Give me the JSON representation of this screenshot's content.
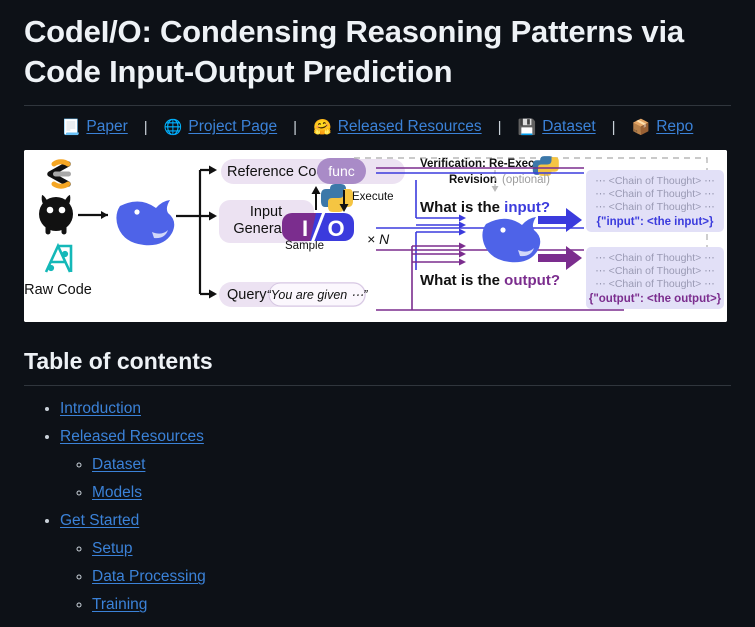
{
  "header": {
    "title": "CodeI/O: Condensing Reasoning Patterns via Code Input-Output Prediction"
  },
  "linkbar": {
    "separator": "|",
    "links": [
      {
        "icon": "page-with-curl-icon",
        "emoji": "📃",
        "label": "Paper"
      },
      {
        "icon": "globe-icon",
        "emoji": "🌐",
        "label": "Project Page"
      },
      {
        "icon": "hugging-face-icon",
        "emoji": "🤗",
        "label": "Released Resources"
      },
      {
        "icon": "floppy-disk-icon",
        "emoji": "💾",
        "label": "Dataset"
      },
      {
        "icon": "package-icon",
        "emoji": "📦",
        "label": "Repo"
      }
    ]
  },
  "figure": {
    "alt": "CodeI/O pipeline diagram",
    "labels": {
      "raw_code": "Raw Code",
      "reference_code": "Reference Code",
      "func": "func",
      "input_generator_line1": "Input",
      "input_generator_line2": "Generator",
      "query": "Query",
      "query_quote": "“You are given ⋯”",
      "sample": "Sample",
      "execute": "Execute",
      "io_i": "I",
      "io_slash": "/",
      "io_o": "O",
      "times_n": "× N",
      "verification": "Verification: Re-Execute",
      "revision": "Revision",
      "optional": "(optional)",
      "what_is_input_prefix": "What is the ",
      "what_is_input_word": "input?",
      "what_is_output_prefix": "What is the ",
      "what_is_output_word": "output?",
      "cot_line": "⋯ <Chain of Thought> ⋯",
      "input_json": "{\"input\": <the input>}",
      "output_json": "{\"output\": <the output>}"
    },
    "colors": {
      "input_blue": "#3b3bdd",
      "output_purple": "#7b2d8e",
      "box_lavender": "#e2e0f7",
      "chip_mauve": "#e7dcef",
      "cot_gray": "#9a9ab4",
      "whale_blue": "#4e63e8",
      "logo_teal": "#14b8b8",
      "logo_orange": "#f5a623"
    }
  },
  "toc": {
    "heading": "Table of contents",
    "items": [
      {
        "label": "Introduction",
        "children": []
      },
      {
        "label": "Released Resources",
        "children": [
          {
            "label": "Dataset"
          },
          {
            "label": "Models"
          }
        ]
      },
      {
        "label": "Get Started",
        "children": [
          {
            "label": "Setup"
          },
          {
            "label": "Data Processing"
          },
          {
            "label": "Training"
          }
        ]
      }
    ]
  }
}
